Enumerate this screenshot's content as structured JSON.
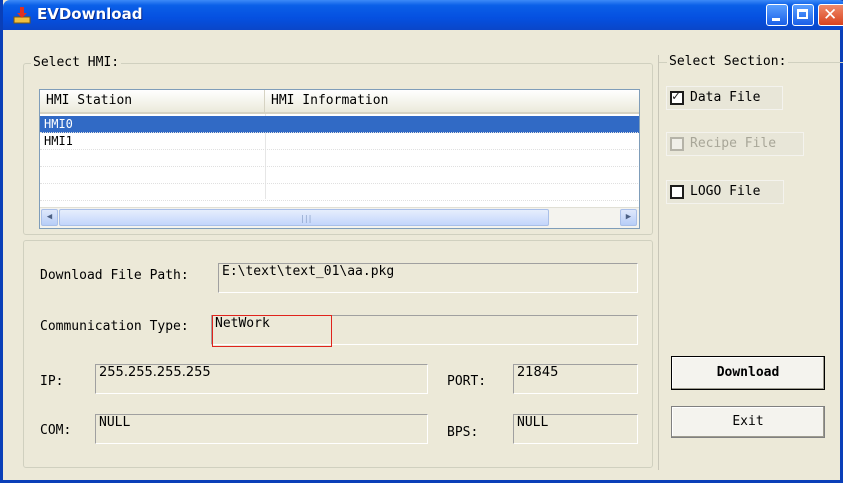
{
  "window": {
    "title": "EVDownload"
  },
  "select_hmi": {
    "legend": "Select HMI:",
    "columns": [
      "HMI Station",
      "HMI Information"
    ],
    "rows": [
      {
        "station": "HMI0",
        "info": "",
        "selected": true
      },
      {
        "station": "HMI1",
        "info": "",
        "selected": false
      }
    ]
  },
  "settings": {
    "download_path_label": "Download File Path:",
    "download_path_value": "E:\\text\\text_01\\aa.pkg",
    "comm_type_label": "Communication Type:",
    "comm_type_value": "NetWork",
    "ip_label": "IP:",
    "ip_value": "255.255.255.255",
    "port_label": "PORT:",
    "port_value": "21845",
    "com_label": "COM:",
    "com_value": "NULL",
    "bps_label": "BPS:",
    "bps_value": "NULL"
  },
  "select_section": {
    "legend": "Select Section:",
    "data_file": {
      "label": "Data File",
      "checked": true,
      "enabled": true
    },
    "recipe_file": {
      "label": "Recipe File",
      "checked": false,
      "enabled": false
    },
    "logo_file": {
      "label": "LOGO File",
      "checked": false,
      "enabled": true
    }
  },
  "buttons": {
    "download": "Download",
    "exit": "Exit"
  },
  "icons": [
    "download-app-icon",
    "minimize-icon",
    "maximize-icon",
    "close-icon",
    "scroll-left-icon",
    "scroll-right-icon",
    "checkmark-icon"
  ],
  "colors": {
    "title_bar": "#0550e0",
    "selection": "#316ac5",
    "highlight_box": "#e0231c"
  }
}
